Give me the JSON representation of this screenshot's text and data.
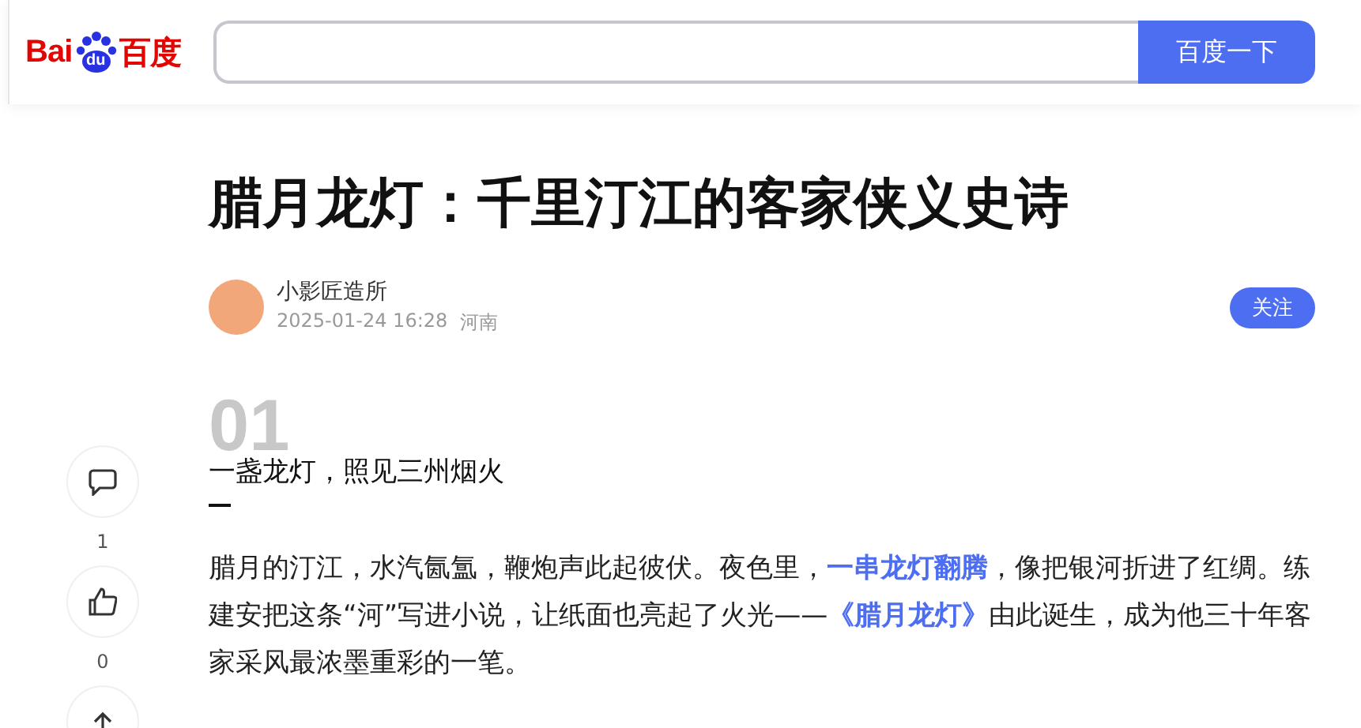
{
  "header": {
    "logo": {
      "part_1": "Bai",
      "part_2": "du",
      "part_3": "百度"
    },
    "search": {
      "button": "百度一下"
    }
  },
  "article": {
    "title": "腊月龙灯：千里汀江的客家侠义史诗",
    "author": {
      "name": "小影匠造所",
      "date": "2025-01-24 16:28",
      "location": "河南",
      "follow": "关注"
    },
    "section": {
      "number": "01",
      "heading": "一盏龙灯，照见三州烟火"
    },
    "paragraph": "腊月的汀江，水汽氤氲，鞭炮声此起彼伏。夜色里，**一串龙灯翻腾**，像把银河折进了红绸。练建安把这条“河”写进小说，让纸面也亮起了火光——**《腊月龙灯》**由此诞生，成为他三十年客家采风最浓墨重彩的一笔。"
  },
  "side_actions": [
    {
      "kind": "comment",
      "count": "1"
    },
    {
      "kind": "like",
      "count": "0"
    },
    {
      "kind": "share"
    }
  ]
}
